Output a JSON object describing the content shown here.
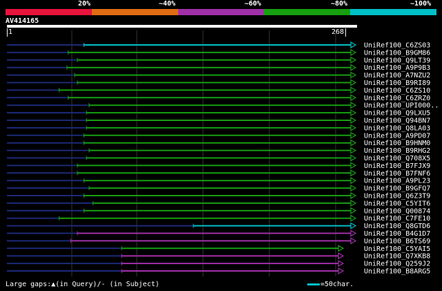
{
  "legend": {
    "colors": [
      "#e8143c",
      "#e06c14",
      "#a030a8",
      "#16a010",
      "#00c0c8"
    ],
    "labels": [
      "20%",
      "~40%",
      "~60%",
      "~80%",
      "~100%"
    ]
  },
  "query": {
    "name": "AV414165",
    "start": "1",
    "end": "268"
  },
  "footer": {
    "gaps_label": "Large gaps:▲(in Query)/- (in Subject)",
    "scale_label": "=50char."
  },
  "scale_color": "#00c0c8",
  "hits": [
    {
      "label": "UniRef100_C6ZS03",
      "start": 60,
      "color": "#00c0c8",
      "lead": "dark"
    },
    {
      "label": "UniRef100_B9GM86",
      "start": 48,
      "color": "#16a010",
      "lead": "dark"
    },
    {
      "label": "UniRef100_Q9LT39",
      "start": 55,
      "color": "#16a010",
      "lead": "dark"
    },
    {
      "label": "UniRef100_A9P9B3",
      "start": 47,
      "color": "#16a010",
      "lead": "dark"
    },
    {
      "label": "UniRef100_A7NZU2",
      "start": 53,
      "color": "#16a010",
      "lead": "dark"
    },
    {
      "label": "UniRef100_B9RI89",
      "start": 55,
      "color": "#16a010",
      "lead": "dark"
    },
    {
      "label": "UniRef100_C6ZS10",
      "start": 41,
      "color": "#16a010",
      "lead": "dark"
    },
    {
      "label": "UniRef100_C6ZRZ0",
      "start": 48,
      "color": "#16a010",
      "lead": "dark"
    },
    {
      "label": "UniRef100_UPI000..",
      "start": 64,
      "color": "#16a010",
      "lead": "dark"
    },
    {
      "label": "UniRef100_Q9LXU5",
      "start": 62,
      "color": "#16a010",
      "lead": "dark"
    },
    {
      "label": "UniRef100_Q94BN7",
      "start": 62,
      "color": "#16a010",
      "lead": "dark"
    },
    {
      "label": "UniRef100_Q8LA03",
      "start": 62,
      "color": "#16a010",
      "lead": "dark"
    },
    {
      "label": "UniRef100_A9PD07",
      "start": 60,
      "color": "#16a010",
      "lead": "dark"
    },
    {
      "label": "UniRef100_B9HNM0",
      "start": 60,
      "color": "#16a010",
      "lead": "dark"
    },
    {
      "label": "UniRef100_B9RHG2",
      "start": 64,
      "color": "#16a010",
      "lead": "dark"
    },
    {
      "label": "UniRef100_Q708X5",
      "start": 62,
      "color": "#16a010",
      "lead": "dark"
    },
    {
      "label": "UniRef100_B7FJX9",
      "start": 55,
      "color": "#16a010",
      "lead": "dark"
    },
    {
      "label": "UniRef100_B7FNF6",
      "start": 55,
      "color": "#16a010",
      "lead": "dark"
    },
    {
      "label": "UniRef100_A9PL23",
      "start": 60,
      "color": "#16a010",
      "lead": "dark"
    },
    {
      "label": "UniRef100_B9GFQ7",
      "start": 64,
      "color": "#16a010",
      "lead": "dark"
    },
    {
      "label": "UniRef100_Q6Z3T9",
      "start": 60,
      "color": "#16a010",
      "lead": "dark"
    },
    {
      "label": "UniRef100_C5YIT6",
      "start": 67,
      "color": "#16a010",
      "lead": "dark"
    },
    {
      "label": "UniRef100_Q00874",
      "start": 60,
      "color": "#16a010",
      "lead": "dark"
    },
    {
      "label": "UniRef100_C7FE10",
      "start": 41,
      "color": "#16a010",
      "lead": "dark"
    },
    {
      "label": "UniRef100_Q8GTD6",
      "start": 144,
      "color": "#00c0c8",
      "lead": "dark"
    },
    {
      "label": "UniRef100_B4G1D7",
      "start": 55,
      "color": "#a030a8",
      "lead": "dark"
    },
    {
      "label": "UniRef100_B6TS69",
      "start": 50,
      "color": "#a030a8",
      "lead": "dark"
    },
    {
      "label": "UniRef100_C5YAI5",
      "start": 89,
      "color": "#16a010",
      "lead": "dark"
    },
    {
      "label": "UniRef100_Q7XKB8",
      "start": 89,
      "color": "#a030a8",
      "lead": "dark"
    },
    {
      "label": "UniRef100_Q259J2",
      "start": 89,
      "color": "#a030a8",
      "lead": "dark"
    },
    {
      "label": "UniRef100_B8ARG5",
      "start": 89,
      "color": "#a030a8",
      "lead": "dark"
    }
  ]
}
